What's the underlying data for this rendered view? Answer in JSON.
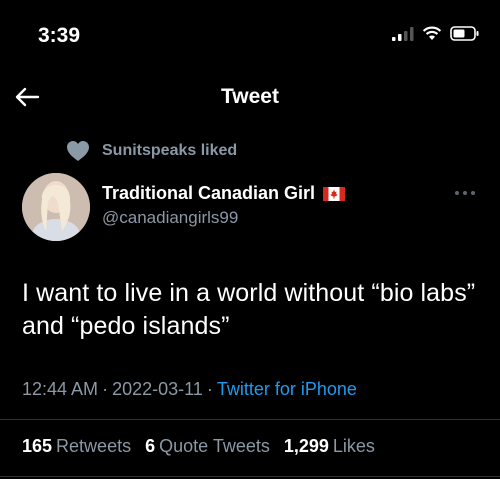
{
  "status_bar": {
    "time": "3:39"
  },
  "nav": {
    "title": "Tweet"
  },
  "social_context": {
    "text": "Sunitspeaks liked"
  },
  "author": {
    "display_name": "Traditional Canadian Girl",
    "handle": "@canadiangirls99"
  },
  "tweet": {
    "text": "I want to live in a world without “bio labs” and “pedo islands”"
  },
  "meta": {
    "time": "12:44 AM",
    "date": "2022-03-11",
    "source": "Twitter for iPhone",
    "separator": "·"
  },
  "stats": {
    "retweets_count": "165",
    "retweets_label": "Retweets",
    "quotes_count": "6",
    "quotes_label": "Quote Tweets",
    "likes_count": "1,299",
    "likes_label": "Likes"
  },
  "colors": {
    "background": "#000000",
    "accent": "#1d9bf0",
    "secondary_text": "#8b98a5"
  },
  "icons": [
    "signal-icon",
    "wifi-icon",
    "battery-icon",
    "back-arrow-icon",
    "heart-icon",
    "canada-flag-icon",
    "more-options-icon"
  ]
}
